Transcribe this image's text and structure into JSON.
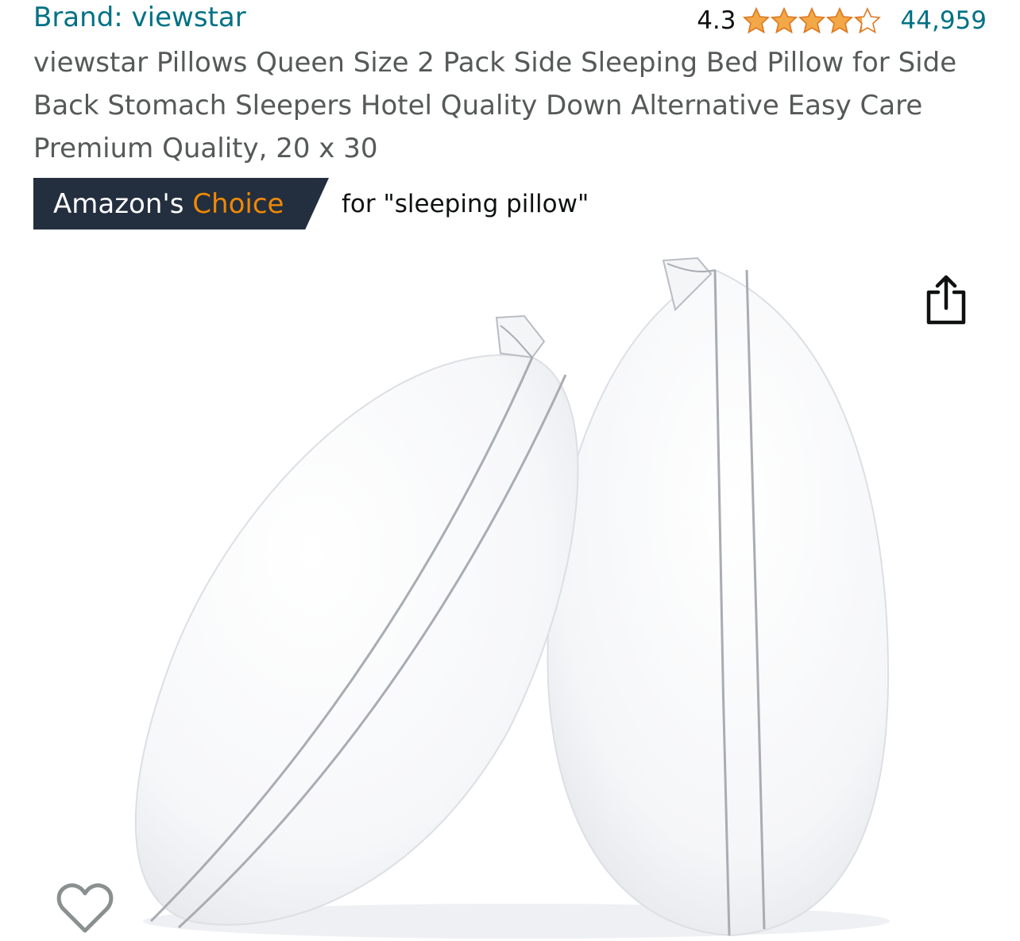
{
  "product": {
    "brand_label": "Brand: viewstar",
    "rating": "4.3",
    "rating_value": 4.3,
    "rating_max": 5,
    "review_count": "44,959",
    "title": "viewstar Pillows Queen Size 2 Pack Side Sleeping Bed Pillow for Side Back Stomach Sleepers Hotel Quality Down Alternative Easy Care Premium Quality, 20 x 30"
  },
  "badge": {
    "prefix": "Amazon's ",
    "accent": "Choice",
    "keyword_text": "for \"sleeping pillow\""
  },
  "icons": {
    "share": "share-icon",
    "favorite": "heart-icon",
    "star": "star-icon"
  },
  "colors": {
    "link": "#007185",
    "badge_bg": "#232f3e",
    "badge_accent": "#f08804",
    "star_fill": "#f3a847",
    "star_stroke": "#de7921",
    "title_text": "#565959"
  }
}
